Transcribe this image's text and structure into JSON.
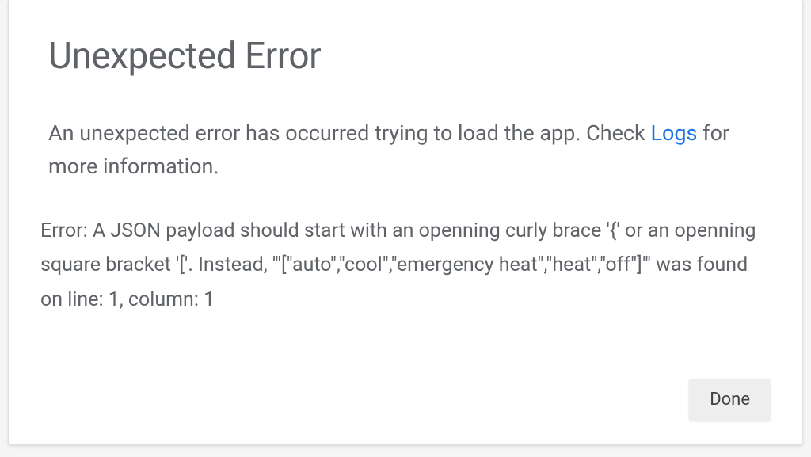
{
  "dialog": {
    "title": "Unexpected Error",
    "description_pre": "An unexpected error has occurred trying to load the app. Check ",
    "description_link": "Logs",
    "description_post": " for more information.",
    "error_message": "Error: A JSON payload should start with an openning curly brace '{' or an openning square bracket '['. Instead, '\"[\"auto\",\"cool\",\"emergency heat\",\"heat\",\"off\"]\"' was found on line: 1, column: 1",
    "done_label": "Done"
  }
}
